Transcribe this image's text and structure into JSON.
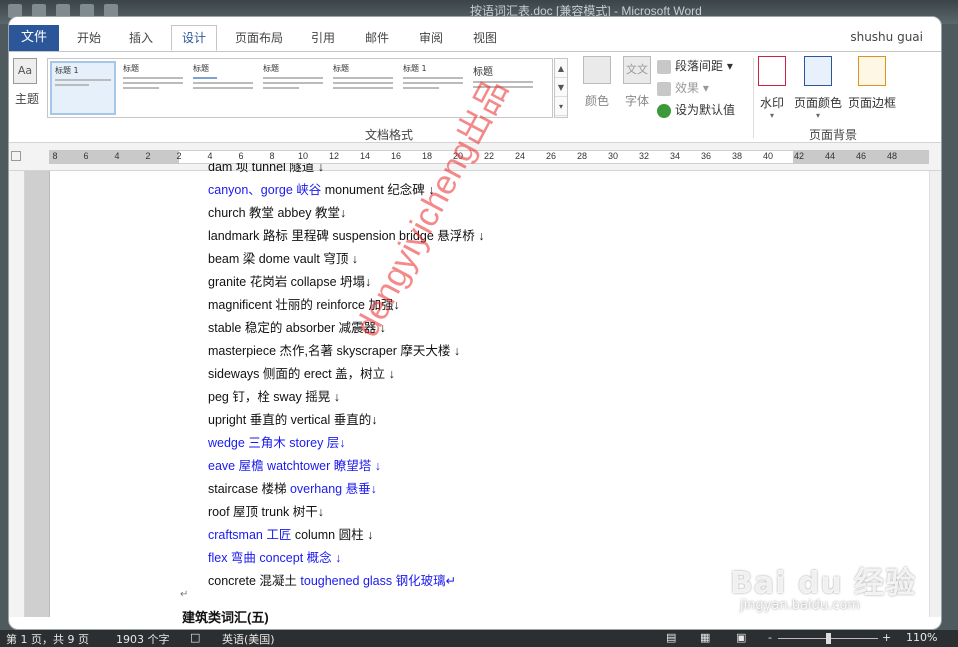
{
  "window": {
    "title": "按语词汇表.doc [兼容模式] - Microsoft Word"
  },
  "tabs": {
    "file": "文件",
    "items": [
      "开始",
      "插入",
      "设计",
      "页面布局",
      "引用",
      "邮件",
      "审阅",
      "视图"
    ],
    "active": "设计",
    "user": "shushu guai"
  },
  "ribbon": {
    "theme_label": "主题",
    "theme_icon_text": "Aa",
    "style_thumbs": [
      "标题 1",
      "标题",
      "标题",
      "标题",
      "标题",
      "标题 1",
      "标题",
      "标题"
    ],
    "group_doc_format": "文档格式",
    "colors_label": "颜色",
    "fonts_label": "字体",
    "fonts_icon_text": "文文",
    "paragraph_spacing": "段落间距",
    "effects": "效果",
    "set_default": "设为默认值",
    "watermark": "水印",
    "page_color": "页面颜色",
    "page_borders": "页面边框",
    "group_page_bg": "页面背景"
  },
  "ruler": {
    "ticks": [
      "8",
      "6",
      "4",
      "2",
      "2",
      "4",
      "6",
      "8",
      "10",
      "12",
      "14",
      "16",
      "18",
      "20",
      "22",
      "24",
      "26",
      "28",
      "30",
      "32",
      "34",
      "36",
      "38",
      "40",
      "42",
      "44",
      "46",
      "48"
    ]
  },
  "document": {
    "top_partial": "dam  坝    tunnel 隧道 ↓",
    "lines": [
      {
        "text": "canyon、gorge  峡谷     monument  纪念碑  ↓",
        "blue_prefix": "canyon、gorge  峡谷",
        "rest": "     monument  纪念碑  ↓"
      },
      {
        "text": "church      教堂     abbey  教堂↓"
      },
      {
        "text": "landmark  路标  里程碑     suspension bridge 悬浮桥  ↓"
      },
      {
        "text": "beam  梁     dome vault  穹顶  ↓"
      },
      {
        "text": "granite  花岗岩     collapse  坍塌↓"
      },
      {
        "text": "magnificent  壮丽的     reinforce  加强↓"
      },
      {
        "text": "stable  稳定的     absorber 减震器  ↓"
      },
      {
        "text": "masterpiece  杰作,名著     skyscraper 摩天大楼  ↓"
      },
      {
        "text": "sideways  侧面的     erect  盖，树立  ↓"
      },
      {
        "text": "peg 钉，栓     sway  摇晃  ↓"
      },
      {
        "text": "upright 垂直的     vertical 垂直的↓"
      },
      {
        "text": "wedge 三角木     storey  层↓",
        "blue": true
      },
      {
        "text": "eave  屋檐     watchtower 瞭望塔  ↓",
        "blue": true
      },
      {
        "text": "staircase 楼梯     overhang  悬垂↓",
        "blue_suffix": "overhang  悬垂↓",
        "rest": "staircase 楼梯     "
      },
      {
        "text": "roof  屋顶     trunk  树干↓"
      },
      {
        "text": "craftsman 工匠     column  圆柱  ↓",
        "blue_prefix": "craftsman 工匠",
        "rest": "     column  圆柱  ↓"
      },
      {
        "text": "flex  弯曲     concept 概念  ↓",
        "blue": true
      },
      {
        "text": "concrete  混凝土     toughened glass  钢化玻璃↵",
        "blue_suffix": "toughened glass  钢化玻璃↵",
        "rest": "concrete  混凝土     "
      }
    ],
    "para_mark": "↵",
    "next_heading": "建筑类词汇(五)",
    "watermark_text": "dengyiyicheng出品"
  },
  "statusbar": {
    "page": "第 1 页，共 9 页",
    "words": "1903 个字",
    "lang": "英语(美国)",
    "zoom": "110%"
  },
  "baidu": {
    "logo": "Bai du 经验",
    "url": "jingyan.baidu.com"
  },
  "colors": {
    "accent": "#2b579a",
    "blue_text": "#1a1aee",
    "watermark": "#eb2828"
  }
}
